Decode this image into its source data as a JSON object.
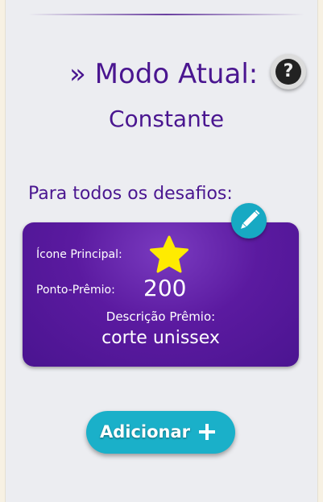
{
  "mode": {
    "title": "» Modo Atual:",
    "value": "Constante",
    "help_icon": "question-icon"
  },
  "section": {
    "label": "Para todos os desafios:"
  },
  "reward_card": {
    "icon_label": "Ícone Principal:",
    "icon": "star-icon",
    "points_label": "Ponto-Prêmio:",
    "points_value": "200",
    "description_label": "Descrição Prêmio:",
    "description_value": "corte unissex",
    "edit_icon": "pencil-icon"
  },
  "actions": {
    "add_label": "Adicionar",
    "add_icon": "plus-icon"
  },
  "colors": {
    "primary_text": "#4a1690",
    "card_bg": "#5b1aa0",
    "accent": "#17a9c3",
    "star": "#ffeb00",
    "panel_bg": "#ecedf1"
  }
}
